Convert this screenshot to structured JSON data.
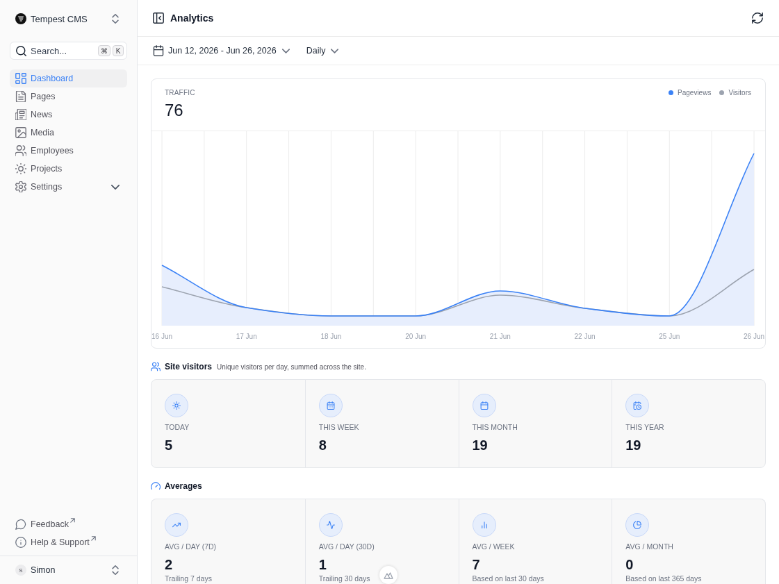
{
  "sidebar": {
    "brand": {
      "name": "Tempest CMS"
    },
    "search": {
      "label": "Search...",
      "shortcut": [
        "⌘",
        "K"
      ]
    },
    "nav_items": [
      {
        "label": "Dashboard",
        "kind": "link",
        "selected": true
      },
      {
        "label": "Pages",
        "kind": "link",
        "selected": false
      },
      {
        "label": "News",
        "kind": "link",
        "selected": false
      },
      {
        "label": "Media",
        "kind": "link",
        "selected": false
      },
      {
        "label": "Employees",
        "kind": "link",
        "selected": false
      },
      {
        "label": "Projects",
        "kind": "link",
        "selected": false
      },
      {
        "label": "Settings",
        "kind": "group",
        "selected": false
      }
    ],
    "footer_links": [
      {
        "label": "Feedback"
      },
      {
        "label": "Help & Support"
      }
    ],
    "user": {
      "initial": "S",
      "name": "Simon"
    }
  },
  "header": {
    "title": "Analytics"
  },
  "toolbar": {
    "date_range": "Jun 12, 2026 - Jun 26, 2026",
    "interval": "Daily"
  },
  "traffic": {
    "label": "TRAFFIC",
    "total": "76",
    "legend": [
      {
        "label": "Pageviews",
        "color": "#3b82f6"
      },
      {
        "label": "Visitors",
        "color": "#9ca3af"
      }
    ],
    "x_labels": [
      "16 Jun",
      "17 Jun",
      "18 Jun",
      "20 Jun",
      "21 Jun",
      "22 Jun",
      "25 Jun",
      "26 Jun"
    ]
  },
  "site_visitors": {
    "title": "Site visitors",
    "description": "Unique visitors per day, summed across the site.",
    "stats": [
      {
        "label": "TODAY",
        "value": "5"
      },
      {
        "label": "THIS WEEK",
        "value": "8"
      },
      {
        "label": "THIS MONTH",
        "value": "19"
      },
      {
        "label": "THIS YEAR",
        "value": "19"
      }
    ]
  },
  "averages": {
    "title": "Averages",
    "stats": [
      {
        "label": "AVG / DAY (7D)",
        "value": "2",
        "note": "Trailing 7 days"
      },
      {
        "label": "AVG / DAY (30D)",
        "value": "1",
        "note": "Trailing 30 days"
      },
      {
        "label": "AVG / WEEK",
        "value": "7",
        "note": "Based on last 30 days"
      },
      {
        "label": "AVG / MONTH",
        "value": "0",
        "note": "Based on last 365 days"
      }
    ]
  }
}
